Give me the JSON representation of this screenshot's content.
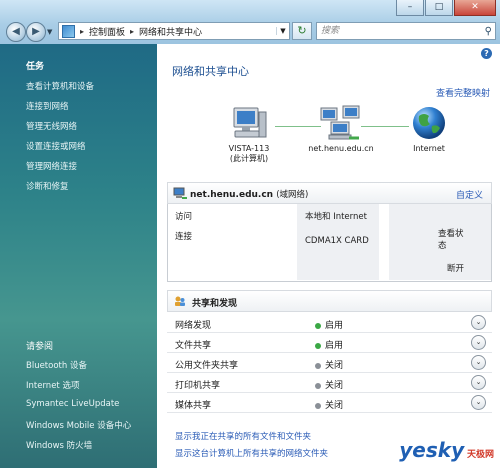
{
  "window": {
    "min": "–",
    "max": "□",
    "close": "✕"
  },
  "toolbar": {
    "back": "◀",
    "forward": "▶",
    "dropdown": "▼",
    "address_sep1": "▸",
    "address_crumb1": "控制面板",
    "address_sep2": "▸",
    "address_crumb2": "网络和共享中心",
    "address_dropdown": "▼",
    "refresh": "↻",
    "search_placeholder": "搜索",
    "search_icon": "⚲"
  },
  "sidebar": {
    "tasks_title": "任务",
    "tasks": [
      "查看计算机和设备",
      "连接到网络",
      "管理无线网络",
      "设置连接或网络",
      "管理网络连接",
      "诊断和修复"
    ],
    "see_also_title": "请参阅",
    "see_also": [
      "Bluetooth 设备",
      "Internet 选项",
      "Symantec LiveUpdate",
      "Windows Mobile 设备中心",
      "Windows 防火墙"
    ]
  },
  "main": {
    "help": "?",
    "title": "网络和共享中心",
    "view_full_map": "查看完整映射",
    "nodes": {
      "computer_line1": "VISTA-113",
      "computer_line2": "(此计算机)",
      "network": "net.henu.edu.cn",
      "internet": "Internet"
    },
    "network": {
      "name": "net.henu.edu.cn",
      "type": "(域网络)",
      "customize": "自定义",
      "access_label": "访问",
      "access_value": "本地和 Internet",
      "connection_label": "连接",
      "connection_value": "CDMA1X CARD",
      "view_status": "查看状态",
      "disconnect": "断开"
    },
    "sharing": {
      "title": "共享和发现",
      "rows": [
        {
          "label": "网络发现",
          "status": "启用",
          "on": true
        },
        {
          "label": "文件共享",
          "status": "启用",
          "on": true
        },
        {
          "label": "公用文件夹共享",
          "status": "关闭",
          "on": false
        },
        {
          "label": "打印机共享",
          "status": "关闭",
          "on": false
        },
        {
          "label": "媒体共享",
          "status": "关闭",
          "on": false
        }
      ]
    },
    "footer_links": [
      "显示我正在共享的所有文件和文件夹",
      "显示这台计算机上所有共享的网络文件夹"
    ]
  },
  "watermark": {
    "brand": "yesky",
    "sub": "天极网"
  },
  "colors": {
    "accent": "#1d4f91",
    "link": "#2a5bb6",
    "status_on": "#3aa845",
    "status_off": "#8a8f96",
    "sidebar": "#2d8289"
  }
}
